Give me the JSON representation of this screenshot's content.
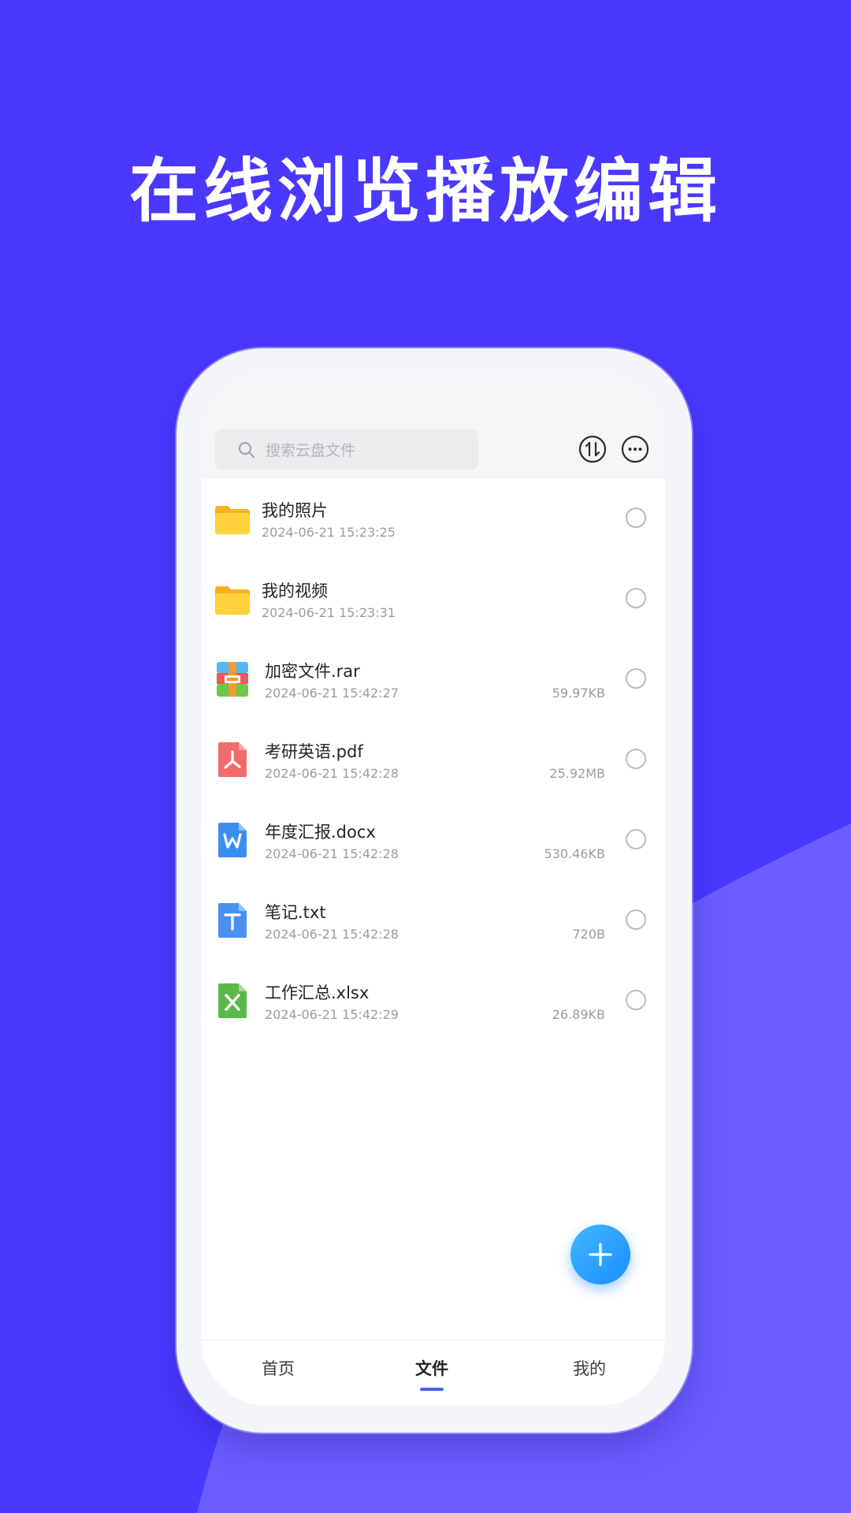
{
  "colors": {
    "background": "#4a38ff",
    "accent": "#4a5cf0",
    "fab": "#2a9dff"
  },
  "headline": "在线浏览播放编辑",
  "search": {
    "placeholder": "搜索云盘文件",
    "icon": "search-icon"
  },
  "toolbar": {
    "sort_icon": "sort-icon",
    "more_icon": "more-icon"
  },
  "files": [
    {
      "name": "我的照片",
      "date": "2024-06-21 15:23:25",
      "size": "",
      "icon": "folder-icon"
    },
    {
      "name": "我的视频",
      "date": "2024-06-21 15:23:31",
      "size": "",
      "icon": "folder-icon"
    },
    {
      "name": "加密文件.rar",
      "date": "2024-06-21 15:42:27",
      "size": "59.97KB",
      "icon": "rar-icon"
    },
    {
      "name": "考研英语.pdf",
      "date": "2024-06-21 15:42:28",
      "size": "25.92MB",
      "icon": "pdf-icon"
    },
    {
      "name": "年度汇报.docx",
      "date": "2024-06-21 15:42:28",
      "size": "530.46KB",
      "icon": "word-icon"
    },
    {
      "name": "笔记.txt",
      "date": "2024-06-21 15:42:28",
      "size": "720B",
      "icon": "txt-icon"
    },
    {
      "name": "工作汇总.xlsx",
      "date": "2024-06-21 15:42:29",
      "size": "26.89KB",
      "icon": "excel-icon"
    }
  ],
  "fab": {
    "icon": "plus-icon"
  },
  "tabs": [
    {
      "label": "首页",
      "active": false
    },
    {
      "label": "文件",
      "active": true
    },
    {
      "label": "我的",
      "active": false
    }
  ]
}
